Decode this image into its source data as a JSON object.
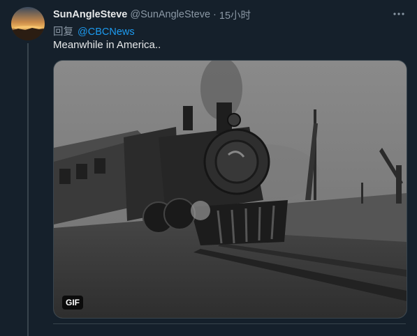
{
  "tweet": {
    "display_name": "SunAngleSteve",
    "handle": "@SunAngleSteve",
    "separator": "·",
    "time": "15小时",
    "reply_prefix": "回复",
    "reply_to": "@CBCNews",
    "text": "Meanwhile in America..",
    "media_badge": "GIF"
  },
  "icons": {
    "more": "more-horizontal-icon",
    "avatar": "sunset-avatar"
  },
  "colors": {
    "background": "#15202b",
    "accent": "#1d9bf0",
    "muted": "#8b98a5",
    "text": "#e7e9ea"
  }
}
